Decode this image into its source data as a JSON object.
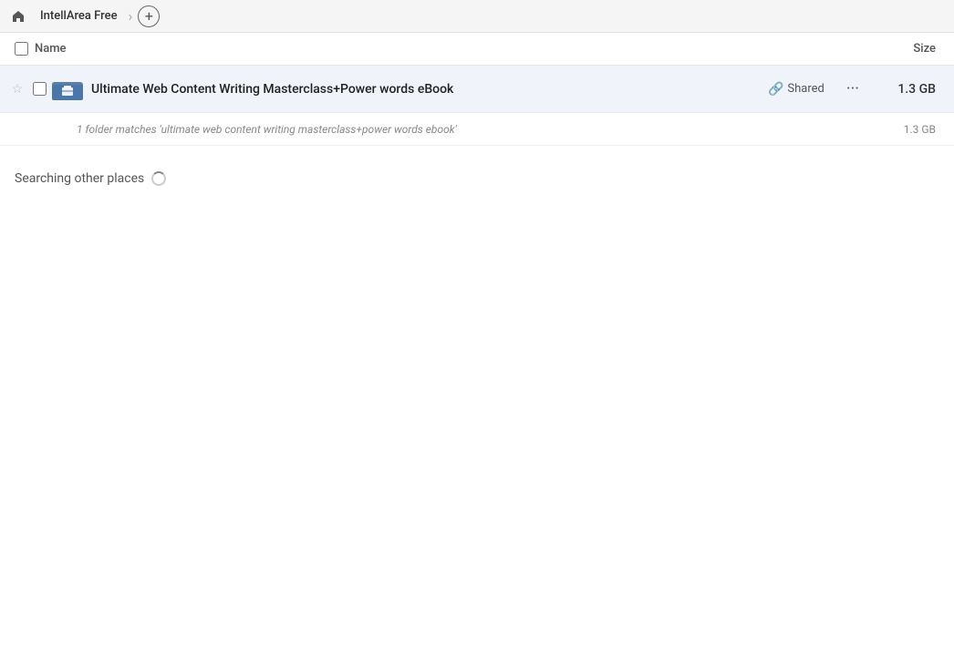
{
  "topbar": {
    "app_name": "IntellArea Free",
    "home_icon": "⌂",
    "add_icon": "+",
    "divider": "›"
  },
  "column_header": {
    "name_label": "Name",
    "size_label": "Size"
  },
  "file_row": {
    "name": "Ultimate Web Content Writing Masterclass+Power words eBook",
    "shared_label": "Shared",
    "size": "1.3 GB",
    "more_icon": "···"
  },
  "match_row": {
    "text": "1 folder matches 'ultimate web content writing masterclass+power words ebook'",
    "size": "1.3 GB"
  },
  "searching_section": {
    "label": "Searching other places"
  }
}
